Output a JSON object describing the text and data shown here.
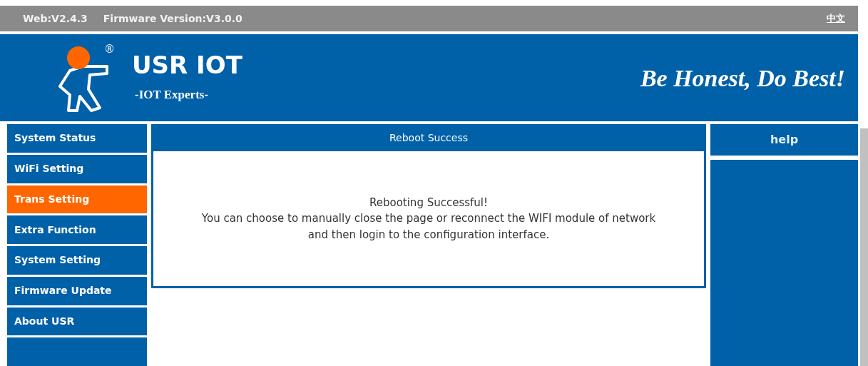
{
  "top_bar": {
    "versions": [
      "Web:V2.4.3",
      "Firmware Version:V3.0.0"
    ],
    "language_link": "中文"
  },
  "header": {
    "registered_mark": "®",
    "brand": "USR IOT",
    "tagline": "-IOT Experts-",
    "slogan": "Be Honest, Do Best!"
  },
  "sidebar": {
    "items": [
      {
        "label": "System Status",
        "selected": false
      },
      {
        "label": "WiFi Setting",
        "selected": false
      },
      {
        "label": "Trans Setting",
        "selected": true
      },
      {
        "label": "Extra Function",
        "selected": false
      },
      {
        "label": "System Setting",
        "selected": false
      },
      {
        "label": "Firmware Update",
        "selected": false
      },
      {
        "label": "About USR",
        "selected": false
      }
    ]
  },
  "main": {
    "title": "Reboot Success",
    "message_lines": [
      "Rebooting Successful!",
      "You can choose to manually close the page or reconnect the WIFI module of network",
      "and then login to the configuration interface."
    ]
  },
  "help_panel": {
    "title": "help"
  }
}
